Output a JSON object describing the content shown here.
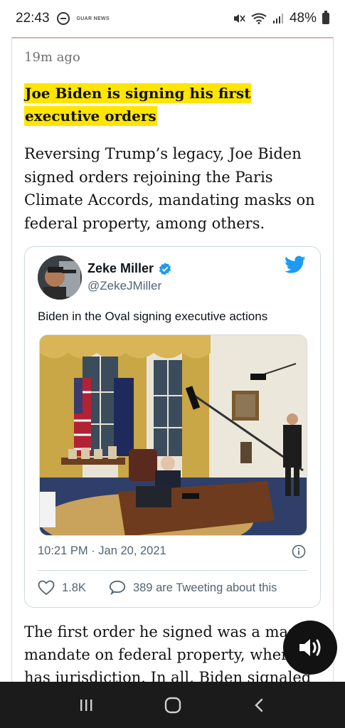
{
  "status_bar": {
    "time": "22:43",
    "news_icon_label": "GUAR NEWS",
    "battery": "48%",
    "icons": [
      "do-not-disturb-icon",
      "news-app-icon",
      "mute-icon",
      "wifi-icon",
      "signal-icon",
      "battery-icon"
    ]
  },
  "article": {
    "timestamp": "19m ago",
    "headline": "Joe Biden is signing his first executive orders",
    "lede": "Reversing Trump’s legacy, Joe Biden signed orders rejoining the Paris Climate Accords, mandating masks on federal property, among others.",
    "body": "The first order he signed was a mask mandate on federal property, where he has jurisdiction. In all, Biden signaled he"
  },
  "tweet": {
    "name": "Zeke Miller",
    "handle": "@ZekeJMiller",
    "text": "Biden in the Oval signing executive actions",
    "time": "10:21 PM · Jan 20, 2021",
    "likes": "1.8K",
    "replies_text": "389 are Tweeting about this",
    "accent_color": "#1d9bf0"
  },
  "colors": {
    "highlight": "#ffe500",
    "text": "#121212",
    "muted": "#707070"
  },
  "nav": {
    "icons": [
      "recent-apps-icon",
      "home-icon",
      "back-icon"
    ]
  }
}
